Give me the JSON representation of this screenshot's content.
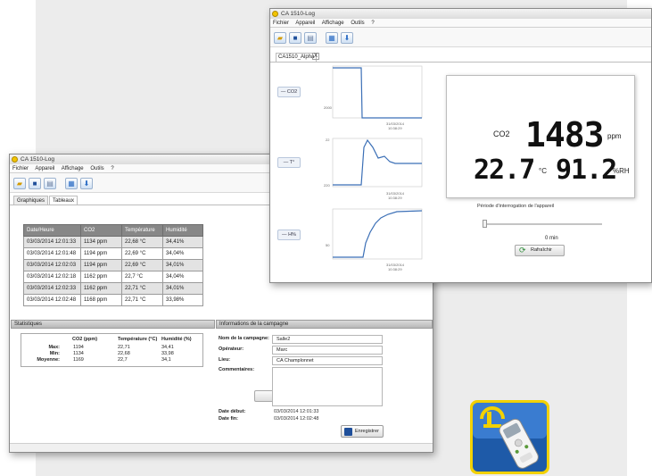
{
  "back_window": {
    "title": "CA 1510-Log",
    "menu": [
      "Fichier",
      "Appareil",
      "Affichage",
      "Outils",
      "?"
    ],
    "tabs": [
      "Graphiques",
      "Tableaux"
    ],
    "table": {
      "headers": [
        "Date/Heure",
        "CO2",
        "Température",
        "Humidité"
      ],
      "rows": [
        [
          "03/03/2014 12:01:33",
          "1134 ppm",
          "22,68 °C",
          "34,41%"
        ],
        [
          "03/03/2014 12:01:48",
          "1194 ppm",
          "22,69 °C",
          "34,04%"
        ],
        [
          "03/03/2014 12:02:03",
          "1194 ppm",
          "22,69 °C",
          "34,01%"
        ],
        [
          "03/03/2014 12:02:18",
          "1162 ppm",
          "22,7 °C",
          "34,04%"
        ],
        [
          "03/03/2014 12:02:33",
          "1162 ppm",
          "22,71 °C",
          "34,01%"
        ],
        [
          "03/03/2014 12:02:48",
          "1168 ppm",
          "22,71 °C",
          "33,98%"
        ]
      ]
    },
    "stats": {
      "title": "Statistiques",
      "col_co2": "CO2 (ppm)",
      "col_temp": "Température (°C)",
      "col_hum": "Humidité (%)",
      "max_label": "Max:",
      "min_label": "Min:",
      "avg_label": "Moyenne:",
      "max": [
        "1194",
        "22,71",
        "34,41"
      ],
      "min": [
        "1134",
        "22,68",
        "33,98"
      ],
      "avg": [
        "1169",
        "22,7",
        "34,1"
      ]
    },
    "campaign": {
      "title": "Informations de la campagne",
      "name_label": "Nom de la campagne:",
      "name_value": "Salle2",
      "operator_label": "Opérateur:",
      "operator_value": "Marc",
      "place_label": "Lieu:",
      "place_value": "CA Champlonnet",
      "comments_label": "Commentaires:",
      "comments_value": "",
      "start_label": "Date début:",
      "start_value": "03/03/2014 12:01:33",
      "end_label": "Date fin:",
      "end_value": "03/03/2014 12:02:48",
      "save_label": "Enregistrer"
    }
  },
  "front_window": {
    "title": "CA 1510-Log",
    "menu": [
      "Fichier",
      "Appareil",
      "Affichage",
      "Outils",
      "?"
    ],
    "tab_label": "CA1510_Alpha",
    "tab_close": "X",
    "channels": [
      "— CO2",
      "— T°",
      "— H%"
    ],
    "chart_dates": [
      "31/03/2014",
      "31/03/2014",
      "31/03/2014"
    ],
    "chart_times": [
      "10:38:29",
      "10:38:29",
      "10:38:29"
    ],
    "chart_ylabels": [
      "2000",
      "22",
      "220",
      "50"
    ],
    "co2_label": "CO2",
    "co2_value": "1483",
    "co2_unit": "ppm",
    "temp_value": "22.7",
    "temp_unit": "°C",
    "hum_value": "91.2",
    "hum_unit": "%RH",
    "period_label": "Période d'interrogation de l'appareil",
    "period_value": "0 min",
    "refresh_label": "Rafraîchir"
  },
  "colors": {
    "table_header": "#878787",
    "plot_line": "#3b6fb6",
    "save_icon": "#1f4f9a"
  }
}
